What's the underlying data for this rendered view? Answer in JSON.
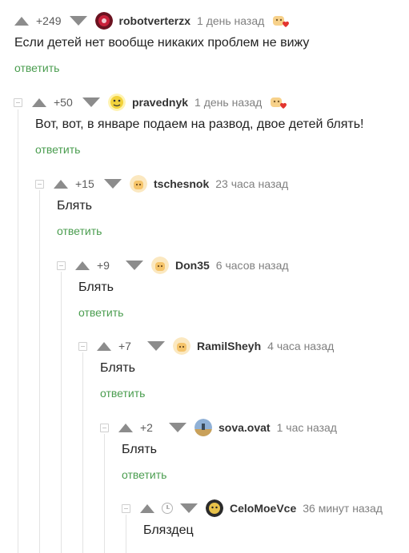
{
  "comments": [
    {
      "rating": "+249",
      "username": "robotverterzx",
      "time": "1 день назад",
      "text": "Если детей нет вообще никаких проблем не вижу",
      "reply_label": "ответить",
      "avatar_icon": "red-robot-avatar-icon",
      "has_award": true
    },
    {
      "rating": "+50",
      "username": "pravednyk",
      "time": "1 день назад",
      "text": "Вот, вот, в январе подаем на развод, двое детей блять!",
      "reply_label": "ответить",
      "avatar_icon": "yellow-face-avatar-icon",
      "has_award": true
    },
    {
      "rating": "+15",
      "username": "tschesnok",
      "time": "23 часа назад",
      "text": "Блять",
      "reply_label": "ответить",
      "avatar_icon": "default-avatar-icon",
      "has_award": false
    },
    {
      "rating": "+9",
      "username": "Don35",
      "time": "6 часов назад",
      "text": "Блять",
      "reply_label": "ответить",
      "avatar_icon": "default-avatar-icon",
      "has_award": false
    },
    {
      "rating": "+7",
      "username": "RamilSheyh",
      "time": "4 часа назад",
      "text": "Блять",
      "reply_label": "ответить",
      "avatar_icon": "default-avatar-icon",
      "has_award": false
    },
    {
      "rating": "+2",
      "username": "sova.ovat",
      "time": "1 час назад",
      "text": "Блять",
      "reply_label": "ответить",
      "avatar_icon": "landscape-avatar-icon",
      "has_award": false
    },
    {
      "rating": "",
      "username": "CeloMoeVce",
      "time": "36 минут назад",
      "text": "Бляздец",
      "reply_label": "",
      "avatar_icon": "dark-avatar-icon",
      "has_award": false
    }
  ],
  "colors": {
    "reply_link": "#4a9d4f",
    "vote_arrow": "#8c8c8c",
    "award_heart": "#e3342f",
    "branch_line": "#e3e3e3"
  }
}
